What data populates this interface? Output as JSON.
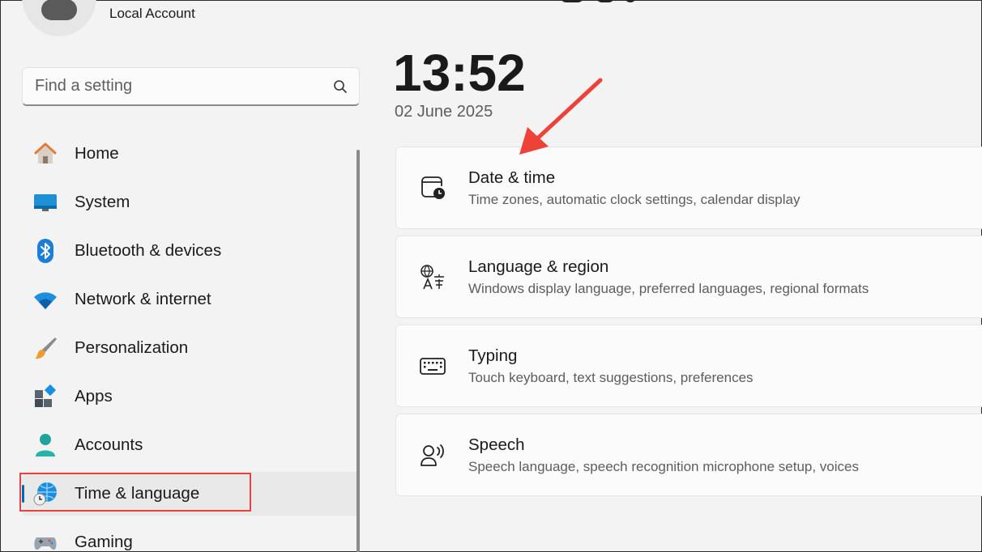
{
  "account": {
    "name": "Local Account"
  },
  "search": {
    "placeholder": "Find a setting"
  },
  "nav": {
    "items": [
      {
        "label": "Home",
        "icon": "home-icon"
      },
      {
        "label": "System",
        "icon": "monitor-icon"
      },
      {
        "label": "Bluetooth & devices",
        "icon": "bluetooth-icon"
      },
      {
        "label": "Network & internet",
        "icon": "wifi-icon"
      },
      {
        "label": "Personalization",
        "icon": "paintbrush-icon"
      },
      {
        "label": "Apps",
        "icon": "apps-icon"
      },
      {
        "label": "Accounts",
        "icon": "person-icon"
      },
      {
        "label": "Time & language",
        "icon": "globe-clock-icon",
        "active": true
      },
      {
        "label": "Gaming",
        "icon": "gamepad-icon"
      }
    ]
  },
  "clock": {
    "time": "13:52",
    "date": "02 June 2025"
  },
  "cards": [
    {
      "title": "Date & time",
      "subtitle": "Time zones, automatic clock settings, calendar display",
      "icon": "calendar-clock-icon"
    },
    {
      "title": "Language & region",
      "subtitle": "Windows display language, preferred languages, regional formats",
      "icon": "language-icon"
    },
    {
      "title": "Typing",
      "subtitle": "Touch keyboard, text suggestions, preferences",
      "icon": "keyboard-icon"
    },
    {
      "title": "Speech",
      "subtitle": "Speech language, speech recognition microphone setup, voices",
      "icon": "speech-icon"
    }
  ],
  "colors": {
    "accent": "#0067c0",
    "annotation": "#e54343"
  }
}
